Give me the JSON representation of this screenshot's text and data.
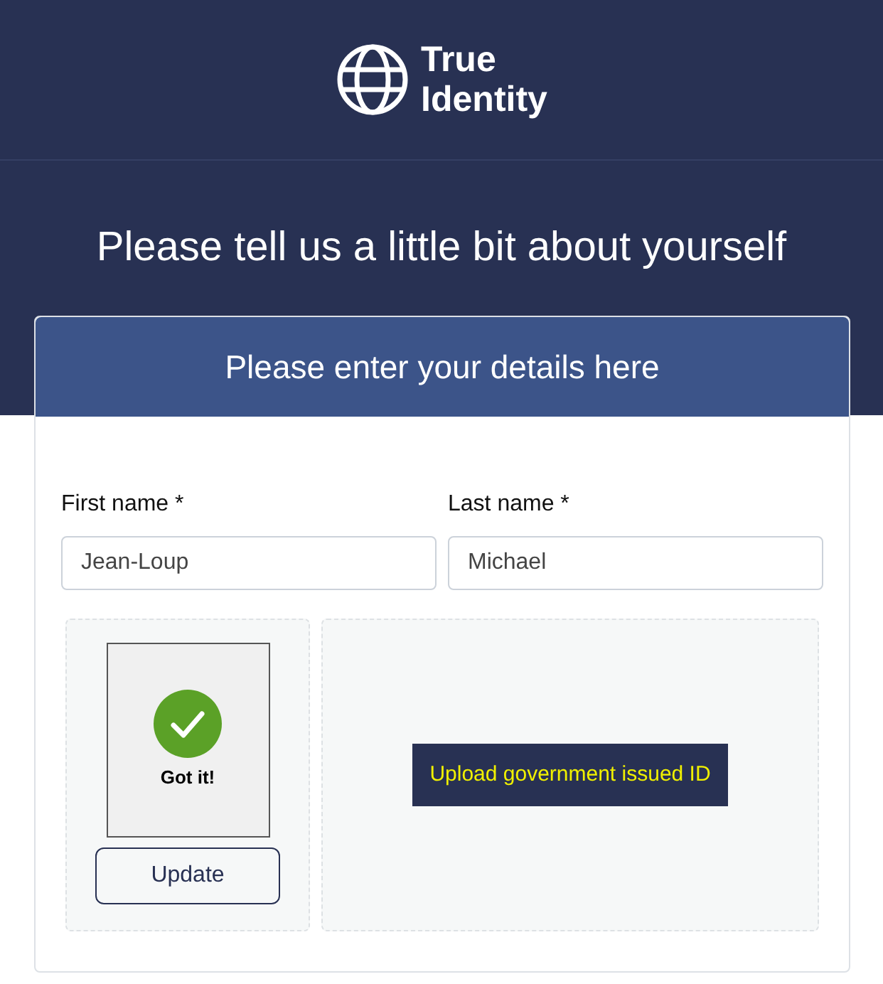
{
  "logo": {
    "line_1": "True",
    "line_2": "Identity"
  },
  "heading": "Please tell us a little bit about yourself",
  "card": {
    "title": "Please enter your details here",
    "fields": [
      {
        "label": "First name *",
        "value": "Jean-Loup"
      },
      {
        "label": "Last name *",
        "value": "Michael"
      }
    ],
    "photo": {
      "captured": true,
      "status": "Got it!",
      "button": "Update"
    },
    "upload": {
      "label": "Upload government issued ID"
    }
  }
}
